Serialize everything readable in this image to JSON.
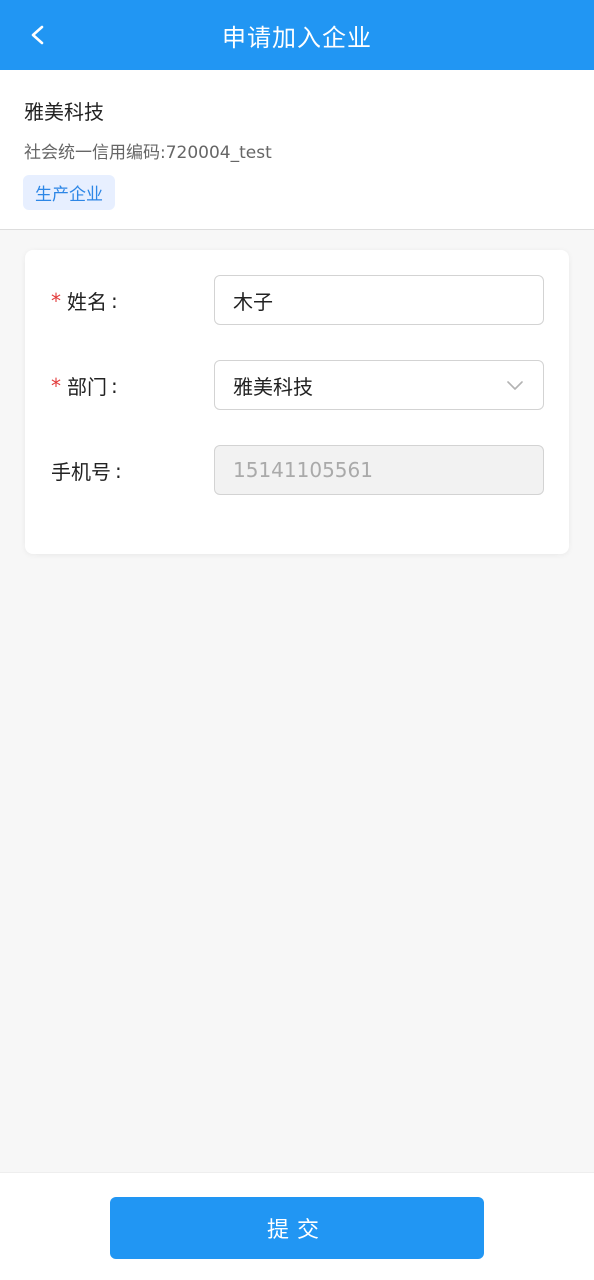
{
  "header": {
    "title": "申请加入企业",
    "back_icon": "chevron-left-icon"
  },
  "company": {
    "name": "雅美科技",
    "credit_code": "社会统一信用编码:720004_test",
    "tag": "生产企业"
  },
  "form": {
    "name_field": {
      "label": "姓名",
      "colon": ":",
      "required_mark": "*",
      "value": "木子"
    },
    "department_field": {
      "label": "部门",
      "colon": ":",
      "required_mark": "*",
      "value": "雅美科技",
      "icon": "chevron-down-icon"
    },
    "phone_field": {
      "label": "手机号",
      "colon": ":",
      "value": "15141105561"
    }
  },
  "actions": {
    "submit_label": "提交"
  },
  "colors": {
    "primary": "#2196F3",
    "required": "#e23b3b",
    "tag_bg": "#e7efff",
    "tag_text": "#2c86e6"
  }
}
